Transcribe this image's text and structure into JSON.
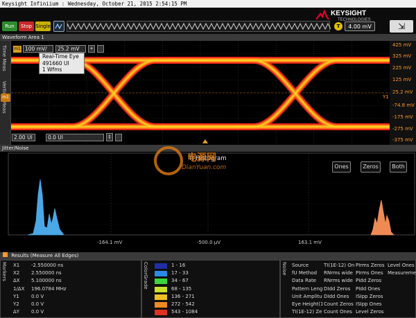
{
  "window": {
    "title": "Keysight Infiniium : Wednesday, October 21, 2015 2:54:15 PM"
  },
  "toolbar": {
    "run": "Run",
    "stop": "Stop",
    "single": "Single",
    "trigger_level": "4.00 mV",
    "trigger_badge": "T",
    "brand": "KEYSIGHT",
    "brand_sub": "TECHNOLOGIES",
    "colors": {
      "run": "#2e8b2e",
      "stop": "#c62828",
      "single": "#c9b200"
    }
  },
  "waveform": {
    "area_title": "Waveform Area 1",
    "side_tabs": [
      "Time Meas",
      "Vertical Meas"
    ],
    "marker_badge": "m1",
    "scale": "100 mV/",
    "offset": "25.2 mV",
    "tooltip": [
      "Real-Time Eye",
      "491660 UI",
      "1 Wfms"
    ],
    "x_left": "2.00 UI",
    "x_offset": "0.0 UI",
    "y_labels": [
      "425 mV",
      "325 mV",
      "225 mV",
      "125 mV",
      "25.2 mV",
      "-74.8 mV",
      "-175 mV",
      "-275 mV",
      "-375 mV"
    ],
    "y1_marker": "Y1",
    "channel_badge": "m1",
    "eye_colors": [
      "#ff2a1a",
      "#ff8a1e",
      "#ffd21e"
    ]
  },
  "jitter": {
    "panel_title": "Jitter/Noise",
    "hist_title": "TI Histogram",
    "buttons": [
      "Ones",
      "Zeros",
      "Both"
    ],
    "x_labels": [
      "-164.1 mV",
      "-500.0 µV",
      "163.1 mV"
    ],
    "watermark": "DianYuan.com",
    "watermark_cn": "电源网",
    "colors": {
      "zeros": "#4aa8e6",
      "ones": "#f08a55"
    }
  },
  "results": {
    "header": "Results   (Measure All Edges)",
    "markers_tab": "Markers",
    "markers": [
      {
        "label": "X1",
        "value": "-2.550000 ns"
      },
      {
        "label": "X2",
        "value": "2.550000 ns"
      },
      {
        "label": "ΔX",
        "value": "5.100000 ns"
      },
      {
        "label": "1/ΔX",
        "value": "196.0784 MHz"
      },
      {
        "label": "Y1",
        "value": "0.0 V"
      },
      {
        "label": "Y2",
        "value": "0.0 V"
      },
      {
        "label": "ΔY",
        "value": "0.0 V"
      }
    ],
    "colorgrade_tab": "ColorGrade",
    "colorgrade": [
      {
        "range": "1 - 16",
        "color": "#1f2fa8"
      },
      {
        "range": "17 - 33",
        "color": "#2a8ae8"
      },
      {
        "range": "34 - 67",
        "color": "#3cd43c"
      },
      {
        "range": "68 - 135",
        "color": "#c8e02a"
      },
      {
        "range": "136 - 271",
        "color": "#f0c020"
      },
      {
        "range": "272 - 542",
        "color": "#f08a20"
      },
      {
        "range": "543 - 1084",
        "color": "#e03020"
      }
    ],
    "noise_tab": "Noise",
    "noise_cols": [
      [
        "Source",
        "fU Method",
        "Data Rate",
        "Pattern Leng",
        "Unit Amplitu",
        "Eye Height(1",
        "TI(1E-12) Zer"
      ],
      [
        "TI(1E-12) On",
        "RNrms wide",
        "RNrms wide",
        "DIdd Zeros",
        "DIdd Ones",
        "Count Zeros",
        "Count Ones"
      ],
      [
        "PIrms Zeros",
        "PIrms Ones",
        "PIdd Zeros",
        "PIdd Ones",
        "ISIpp Zeros",
        "ISIpp Ones",
        "Level Zeros"
      ],
      [
        "Level Ones",
        "Measuremer"
      ]
    ]
  }
}
